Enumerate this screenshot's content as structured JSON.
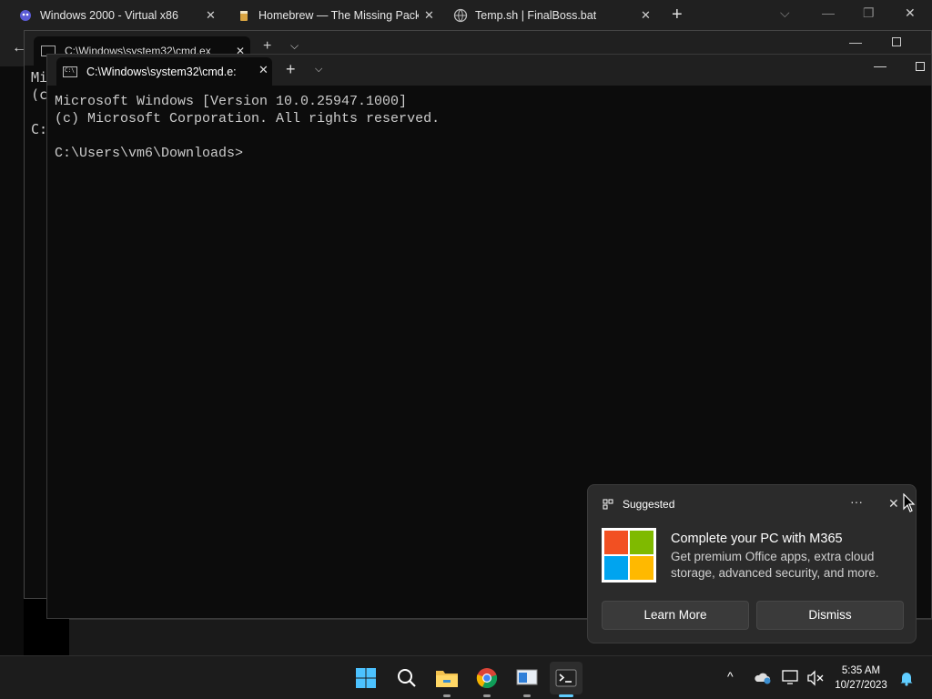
{
  "browser": {
    "tabs": [
      {
        "label": "Windows 2000 - Virtual x86",
        "icon": "virtual-x86-icon"
      },
      {
        "label": "Homebrew — The Missing Packa",
        "icon": "homebrew-icon"
      },
      {
        "label": "Temp.sh | FinalBoss.bat",
        "icon": "globe-icon"
      }
    ]
  },
  "background_terminal": {
    "tab_title": "C:\\Windows\\system32\\cmd.ex",
    "left_lines": [
      "Mi",
      "(c",
      "",
      "C:"
    ]
  },
  "terminal": {
    "tab_title": "C:\\Windows\\system32\\cmd.e:",
    "lines": [
      "Microsoft Windows [Version 10.0.25947.1000]",
      "(c) Microsoft Corporation. All rights reserved.",
      "",
      "C:\\Users\\vm6\\Downloads>"
    ]
  },
  "toast": {
    "header": "Suggested",
    "title": "Complete your PC with M365",
    "body": "Get premium Office apps, extra cloud storage, advanced security, and more.",
    "learn_more": "Learn More",
    "dismiss": "Dismiss",
    "logo_colors": [
      "#f25022",
      "#7fba00",
      "#00a4ef",
      "#ffb900"
    ]
  },
  "taskbar": {
    "time": "5:35 AM",
    "date": "10/27/2023",
    "accent": "#60cdff"
  }
}
